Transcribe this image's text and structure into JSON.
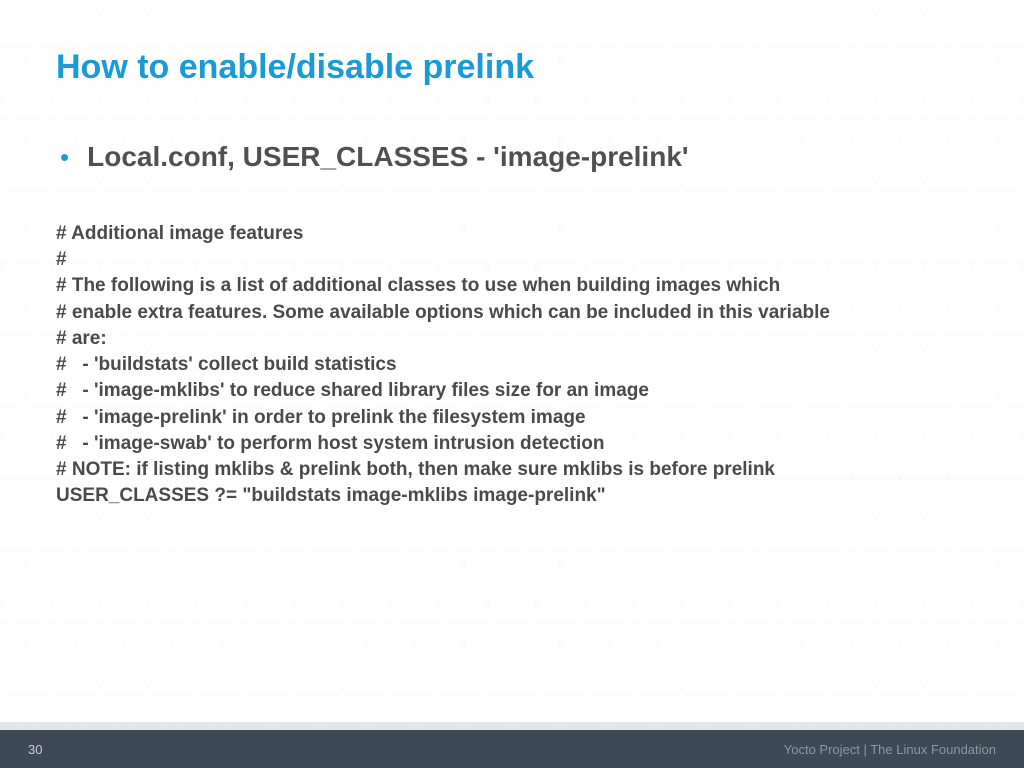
{
  "title": "How to enable/disable prelink",
  "bullet": "Local.conf, USER_CLASSES - 'image-prelink'",
  "code_lines": [
    "# Additional image features",
    "#",
    "# The following is a list of additional classes to use when building images which",
    "# enable extra features. Some available options which can be included in this variable",
    "# are:",
    "#   - 'buildstats' collect build statistics",
    "#   - 'image-mklibs' to reduce shared library files size for an image",
    "#   - 'image-prelink' in order to prelink the filesystem image",
    "#   - 'image-swab' to perform host system intrusion detection",
    "# NOTE: if listing mklibs & prelink both, then make sure mklibs is before prelink",
    "USER_CLASSES ?= \"buildstats image-mklibs image-prelink\""
  ],
  "footer": {
    "page": "30",
    "right": "Yocto Project  |  The Linux Foundation"
  }
}
